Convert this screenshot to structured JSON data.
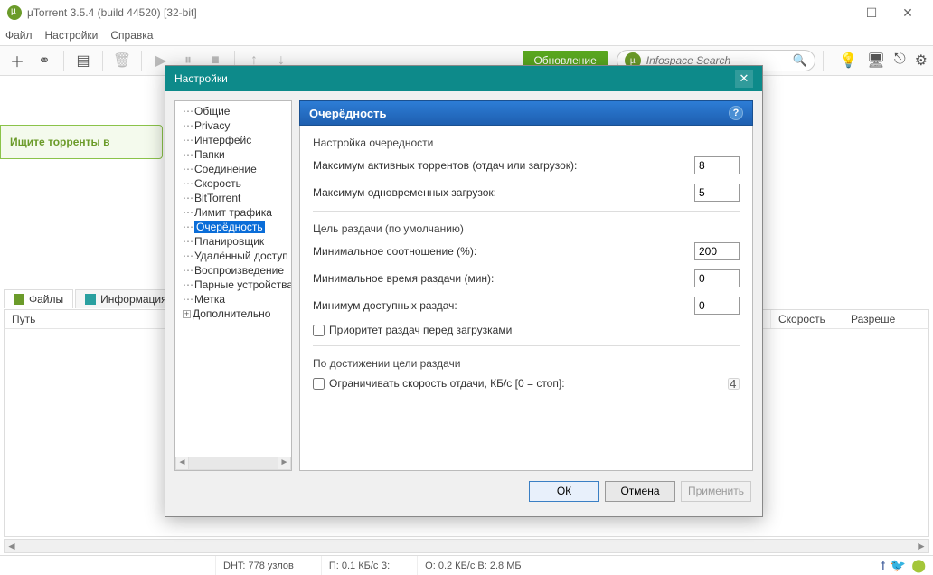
{
  "window": {
    "title": "µTorrent 3.5.4  (build 44520) [32-bit]"
  },
  "menu": {
    "file": "Файл",
    "settings": "Настройки",
    "help": "Справка"
  },
  "toolbar": {
    "upgrade": "Обновление",
    "search_placeholder": "Infospace Search"
  },
  "banner": {
    "text": "Ищите торренты в"
  },
  "tabs": {
    "files": "Файлы",
    "info": "Информация"
  },
  "table": {
    "col_path": "Путь",
    "col_speed": "Скорость",
    "col_resolve": "Разреше"
  },
  "statusbar": {
    "dht": "DHT: 778 узлов",
    "down": "П: 0.1 КБ/с З:",
    "up": "О: 0.2 КБ/с В: 2.8 МБ"
  },
  "dialog": {
    "title": "Настройки",
    "tree": [
      "Общие",
      "Privacy",
      "Интерфейс",
      "Папки",
      "Соединение",
      "Скорость",
      "BitTorrent",
      "Лимит трафика",
      "Очерёдность",
      "Планировщик",
      "Удалённый доступ",
      "Воспроизведение",
      "Парные устройства",
      "Метка",
      "Дополнительно"
    ],
    "tree_selected": 8,
    "page_title": "Очерёдность",
    "group1": "Настройка очередности",
    "row1_label": "Максимум активных торрентов (отдач или загрузок):",
    "row1_value": "8",
    "row2_label": "Максимум одновременных загрузок:",
    "row2_value": "5",
    "group2": "Цель раздачи (по умолчанию)",
    "row3_label": "Минимальное соотношение (%):",
    "row3_value": "200",
    "row4_label": "Минимальное время раздачи (мин):",
    "row4_value": "0",
    "row5_label": "Минимум доступных раздач:",
    "row5_value": "0",
    "check1": "Приоритет раздач перед загрузками",
    "group3": "По достижении цели раздачи",
    "check2": "Ограничивать скорость отдачи, КБ/с [0 = стоп]:",
    "row6_value": "4",
    "btn_ok": "ОК",
    "btn_cancel": "Отмена",
    "btn_apply": "Применить"
  }
}
